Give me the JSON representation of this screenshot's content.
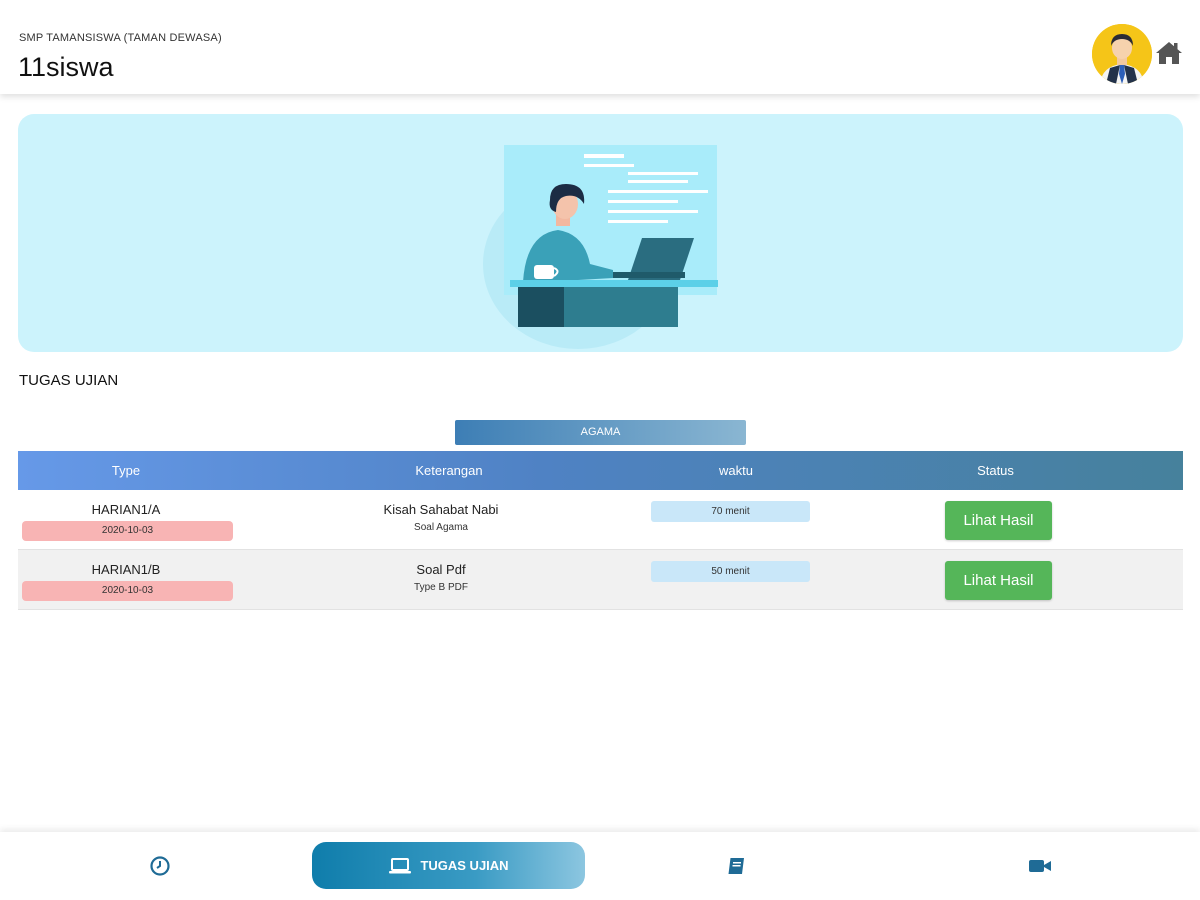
{
  "header": {
    "school": "SMP TAMANSISWA (TAMAN DEWASA)",
    "title": "11siswa"
  },
  "section": {
    "title": "TUGAS UJIAN"
  },
  "subject": {
    "label": "AGAMA"
  },
  "table": {
    "headers": [
      "Type",
      "Keterangan",
      "waktu",
      "Status"
    ],
    "rows": [
      {
        "type": "HARIAN1/A",
        "date": "2020-10-03",
        "title": "Kisah Sahabat Nabi",
        "subtitle": "Soal Agama",
        "waktu": "70 menit",
        "action": "Lihat Hasil"
      },
      {
        "type": "HARIAN1/B",
        "date": "2020-10-03",
        "title": "Soal Pdf",
        "subtitle": "Type B PDF",
        "waktu": "50 menit",
        "action": "Lihat Hasil"
      }
    ]
  },
  "bottom_nav": {
    "items": [
      {
        "icon": "clock-icon"
      },
      {
        "icon": "laptop-icon",
        "label": "TUGAS UJIAN",
        "active": true
      },
      {
        "icon": "book-icon"
      },
      {
        "icon": "video-camera-icon"
      }
    ]
  },
  "colors": {
    "accent": "#0f7dab",
    "success": "#55b659",
    "date_badge": "#f8b4b4",
    "time_badge": "#c9e7f9",
    "banner_bg": "#ccf3fc"
  }
}
